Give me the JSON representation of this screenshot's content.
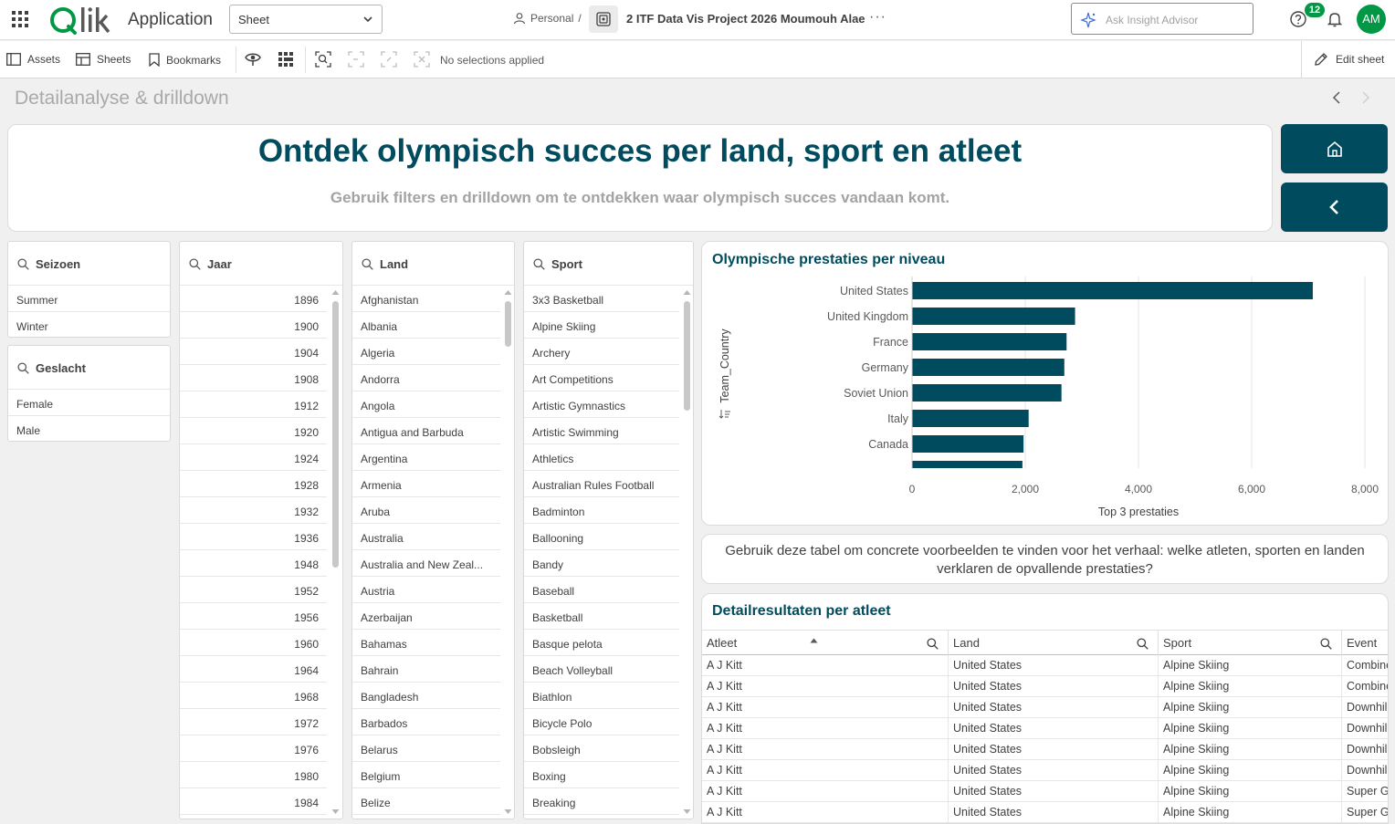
{
  "header": {
    "app_label": "Application",
    "sheet_selector": "Sheet",
    "space": "Personal",
    "separator": "/",
    "app_name": "2 ITF Data Vis Project 2026 Moumouh Alae",
    "more": "···",
    "insight_placeholder": "Ask Insight Advisor",
    "notification_count": "12",
    "user_initials": "AM"
  },
  "toolbar": {
    "assets": "Assets",
    "sheets": "Sheets",
    "bookmarks": "Bookmarks",
    "no_selections": "No selections applied",
    "edit_sheet": "Edit sheet"
  },
  "sheet": {
    "title": "Detailanalyse & drilldown"
  },
  "banner": {
    "title": "Ontdek olympisch succes per land, sport en atleet",
    "subtitle": "Gebruik filters en drilldown om te ontdekken waar olympisch succes vandaan komt."
  },
  "filters": {
    "seizoen": {
      "label": "Seizoen",
      "items": [
        "Summer",
        "Winter"
      ]
    },
    "geslacht": {
      "label": "Geslacht",
      "items": [
        "Female",
        "Male"
      ]
    },
    "jaar": {
      "label": "Jaar",
      "items": [
        "1896",
        "1900",
        "1904",
        "1908",
        "1912",
        "1920",
        "1924",
        "1928",
        "1932",
        "1936",
        "1948",
        "1952",
        "1956",
        "1960",
        "1964",
        "1968",
        "1972",
        "1976",
        "1980",
        "1984"
      ]
    },
    "land": {
      "label": "Land",
      "items": [
        "Afghanistan",
        "Albania",
        "Algeria",
        "Andorra",
        "Angola",
        "Antigua and Barbuda",
        "Argentina",
        "Armenia",
        "Aruba",
        "Australia",
        "Australia and New Zeal...",
        "Austria",
        "Azerbaijan",
        "Bahamas",
        "Bahrain",
        "Bangladesh",
        "Barbados",
        "Belarus",
        "Belgium",
        "Belize"
      ]
    },
    "sport": {
      "label": "Sport",
      "items": [
        "3x3 Basketball",
        "Alpine Skiing",
        "Archery",
        "Art Competitions",
        "Artistic Gymnastics",
        "Artistic Swimming",
        "Athletics",
        "Australian Rules Football",
        "Badminton",
        "Ballooning",
        "Bandy",
        "Baseball",
        "Basketball",
        "Basque pelota",
        "Beach Volleyball",
        "Biathlon",
        "Bicycle Polo",
        "Bobsleigh",
        "Boxing",
        "Breaking"
      ]
    }
  },
  "chart": {
    "title": "Olympische prestaties per niveau"
  },
  "chart_data": {
    "type": "bar",
    "orientation": "horizontal",
    "title": "Olympische prestaties per niveau",
    "ylabel": "Team_Country",
    "xlabel": "Top 3 prestaties",
    "categories": [
      "United States",
      "United Kingdom",
      "France",
      "Germany",
      "Soviet Union",
      "Italy",
      "Canada"
    ],
    "values": [
      7080,
      2880,
      2730,
      2690,
      2640,
      2060,
      1970
    ],
    "partial_next_value": 1950,
    "xlim": [
      0,
      8000
    ],
    "xticks": [
      "0",
      "2,000",
      "4,000",
      "6,000",
      "8,000"
    ],
    "grid": true,
    "bar_color": "#004c5e"
  },
  "story": {
    "text": "Gebruik deze tabel om concrete voorbeelden te vinden voor het verhaal: welke atleten, sporten en landen verklaren de opvallende prestaties?"
  },
  "table": {
    "title": "Detailresultaten per atleet",
    "columns": [
      "Atleet",
      "Land",
      "Sport",
      "Event"
    ],
    "rows": [
      [
        "A J Kitt",
        "United States",
        "Alpine Skiing",
        "Combined"
      ],
      [
        "A J Kitt",
        "United States",
        "Alpine Skiing",
        "Combined"
      ],
      [
        "A J Kitt",
        "United States",
        "Alpine Skiing",
        "Downhill"
      ],
      [
        "A J Kitt",
        "United States",
        "Alpine Skiing",
        "Downhill"
      ],
      [
        "A J Kitt",
        "United States",
        "Alpine Skiing",
        "Downhill"
      ],
      [
        "A J Kitt",
        "United States",
        "Alpine Skiing",
        "Downhill"
      ],
      [
        "A J Kitt",
        "United States",
        "Alpine Skiing",
        "Super G,"
      ],
      [
        "A J Kitt",
        "United States",
        "Alpine Skiing",
        "Super G"
      ]
    ]
  },
  "colors": {
    "brand_green": "#009845",
    "petrol": "#004c5e"
  }
}
